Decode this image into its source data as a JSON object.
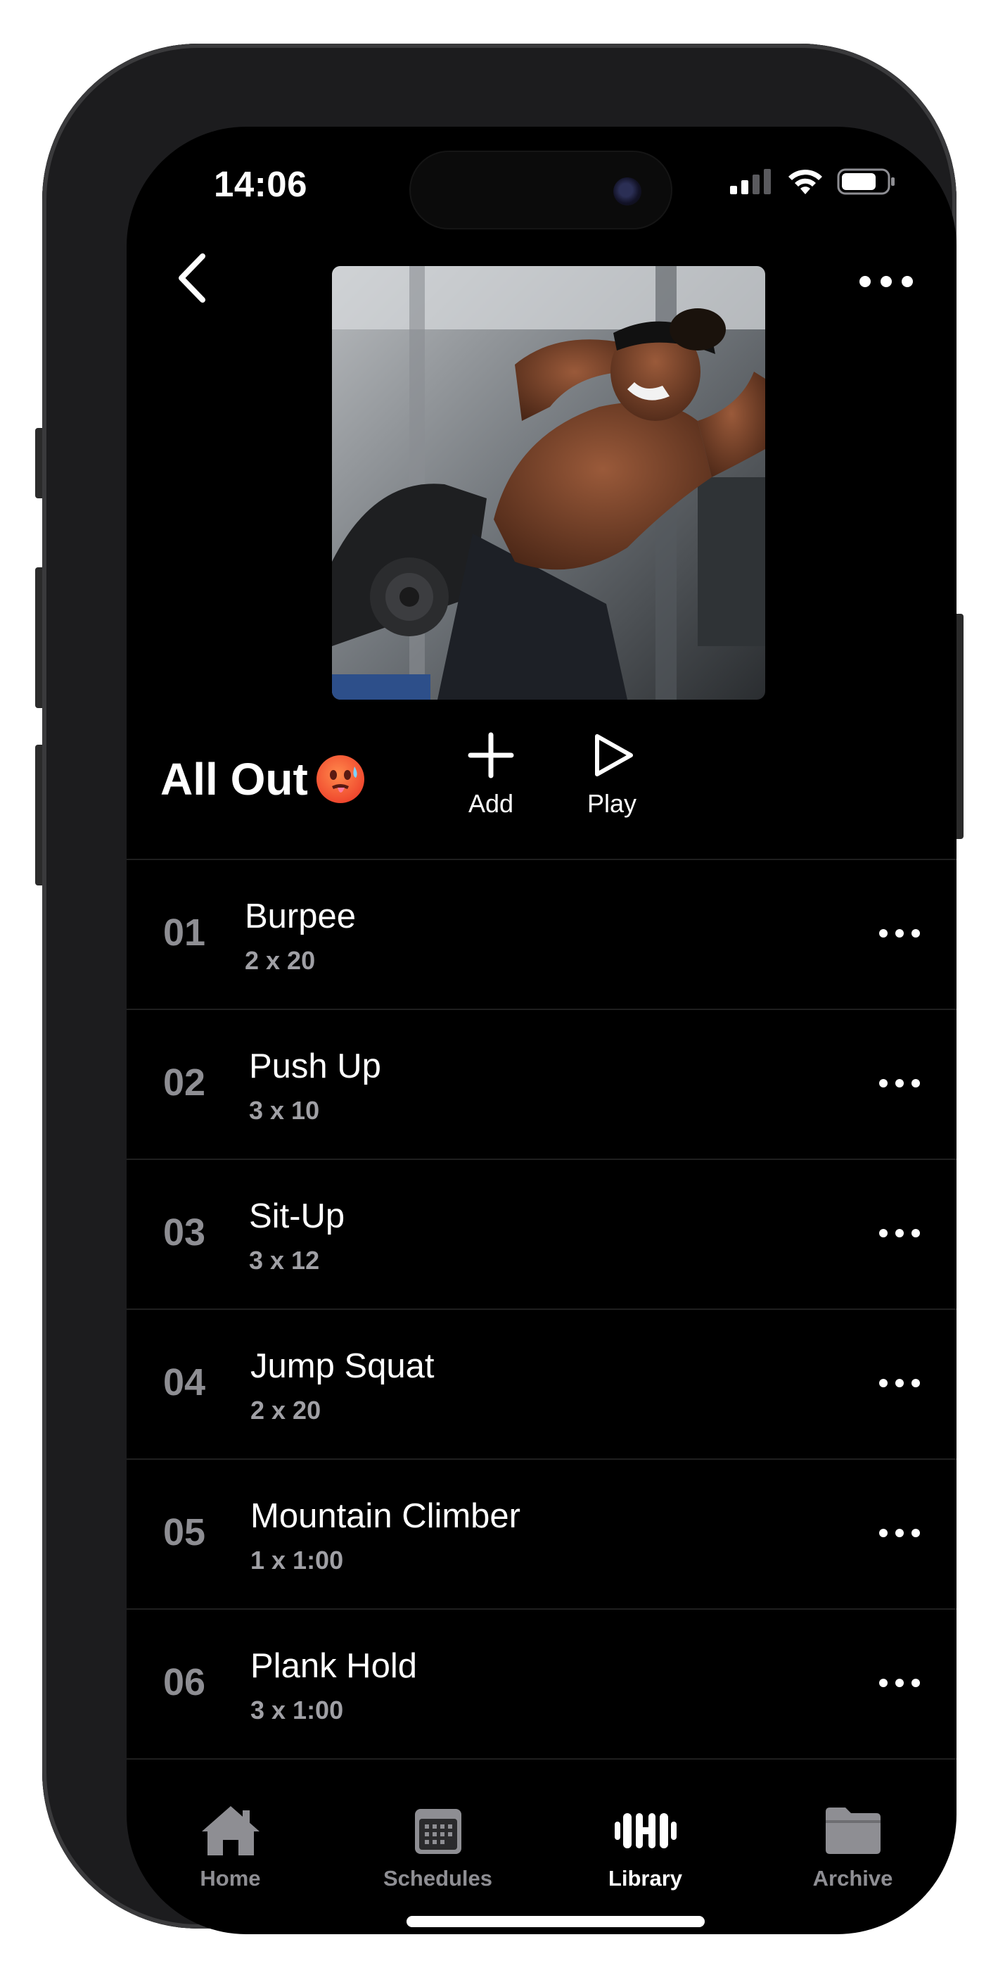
{
  "status_bar": {
    "time": "14:06"
  },
  "header": {
    "back_icon": "chevron-left-icon",
    "more_icon": "ellipsis-icon"
  },
  "playlist": {
    "title": "All Out",
    "emoji": "hot-face-emoji",
    "add_label": "Add",
    "play_label": "Play"
  },
  "exercises": [
    {
      "number": "01",
      "name": "Burpee",
      "sets": "2 x 20"
    },
    {
      "number": "02",
      "name": "Push Up",
      "sets": "3 x 10"
    },
    {
      "number": "03",
      "name": "Sit-Up",
      "sets": "3 x 12"
    },
    {
      "number": "04",
      "name": "Jump Squat",
      "sets": "2 x 20"
    },
    {
      "number": "05",
      "name": "Mountain Climber",
      "sets": "1 x 1:00"
    },
    {
      "number": "06",
      "name": "Plank Hold",
      "sets": "3 x 1:00"
    }
  ],
  "tabs": [
    {
      "label": "Home",
      "icon": "house-icon",
      "active": false
    },
    {
      "label": "Schedules",
      "icon": "calendar-icon",
      "active": false
    },
    {
      "label": "Library",
      "icon": "dumbbell-icon",
      "active": true
    },
    {
      "label": "Archive",
      "icon": "folder-icon",
      "active": false
    }
  ],
  "colors": {
    "background": "#000000",
    "text": "#ffffff",
    "secondary_text": "#8e8e93",
    "divider": "#1f1f1f"
  }
}
